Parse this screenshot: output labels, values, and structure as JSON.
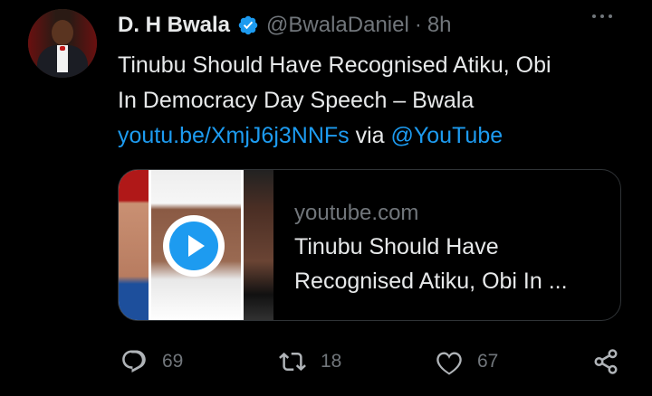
{
  "author": {
    "name": "D. H Bwala",
    "handle": "@BwalaDaniel",
    "separator": "·",
    "time": "8h"
  },
  "tweet": {
    "line1": "Tinubu Should Have Recognised Atiku, Obi",
    "line2": "In Democracy Day Speech – Bwala",
    "link": "youtu.be/XmjJ6j3NNFs",
    "via": " via ",
    "mention": "@YouTube"
  },
  "card": {
    "domain": "youtube.com",
    "title_line1": "Tinubu Should Have",
    "title_line2": "Recognised Atiku, Obi In ..."
  },
  "actions": {
    "replies": "69",
    "retweets": "18",
    "likes": "67"
  },
  "icons": {
    "verified": "verified-badge-icon",
    "more": "more-icon",
    "reply": "reply-icon",
    "retweet": "retweet-icon",
    "like": "heart-icon",
    "share": "share-icon",
    "play": "play-icon"
  },
  "colors": {
    "background": "#000000",
    "text": "#e7e9ea",
    "muted": "#71767b",
    "link": "#1d9bf0"
  }
}
